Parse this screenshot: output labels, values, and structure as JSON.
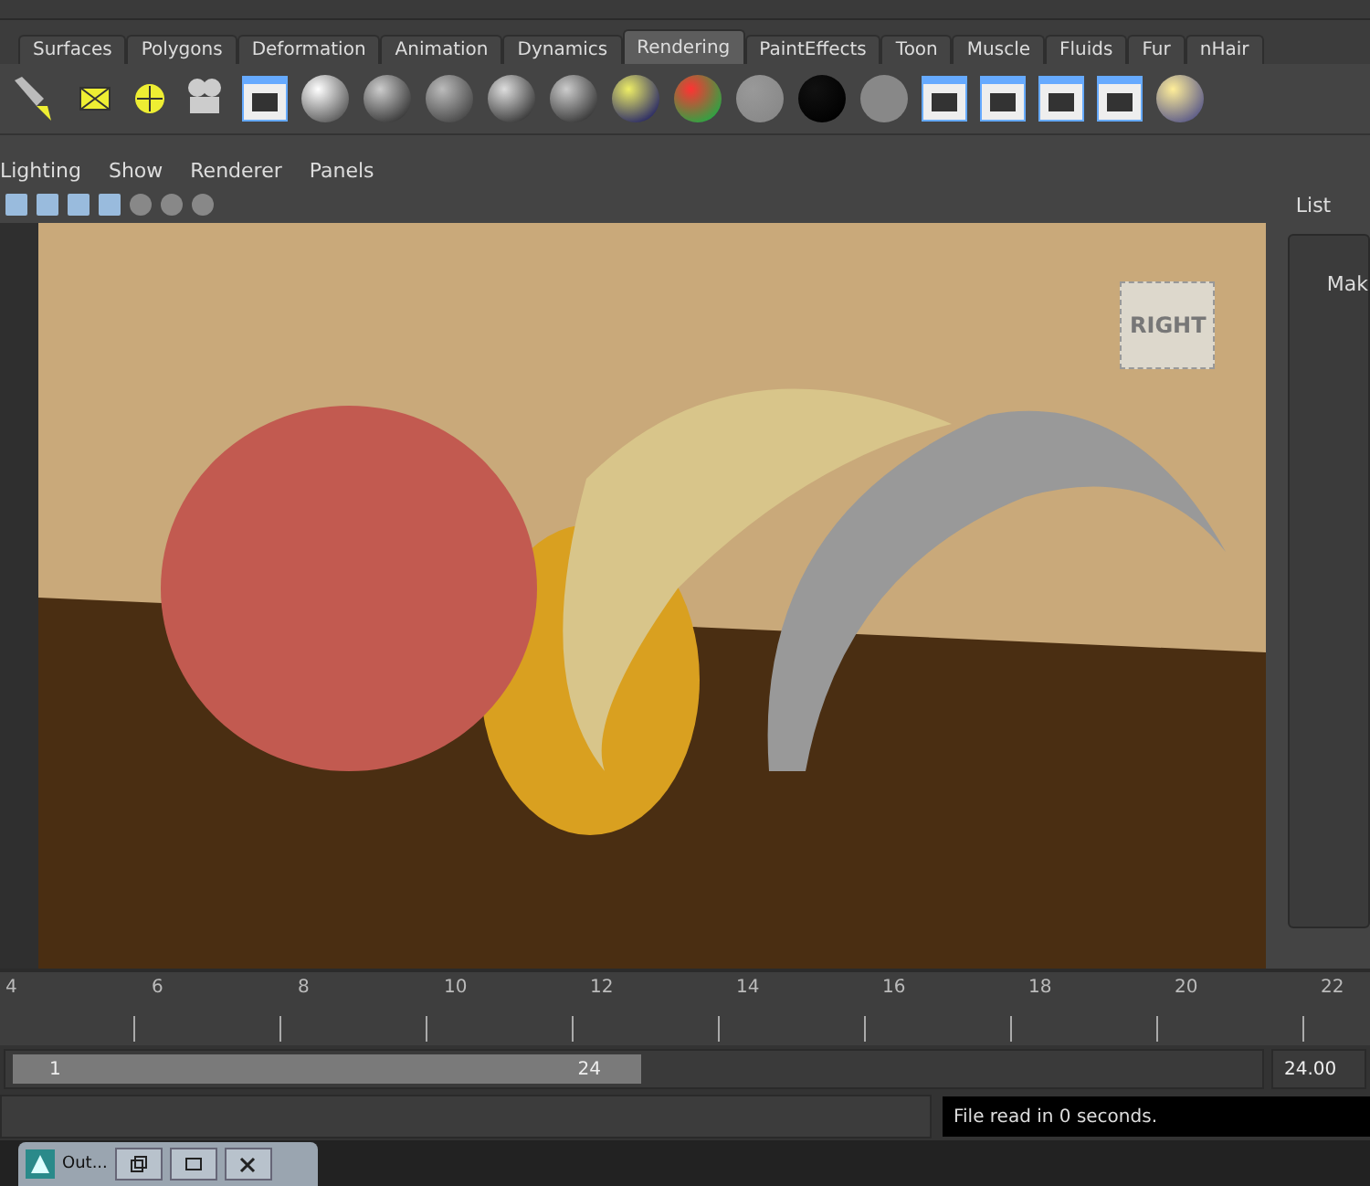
{
  "shelf_tabs": [
    {
      "label": "Surfaces",
      "selected": false
    },
    {
      "label": "Polygons",
      "selected": false
    },
    {
      "label": "Deformation",
      "selected": false
    },
    {
      "label": "Animation",
      "selected": false
    },
    {
      "label": "Dynamics",
      "selected": false
    },
    {
      "label": "Rendering",
      "selected": true
    },
    {
      "label": "PaintEffects",
      "selected": false
    },
    {
      "label": "Toon",
      "selected": false
    },
    {
      "label": "Muscle",
      "selected": false
    },
    {
      "label": "Fluids",
      "selected": false
    },
    {
      "label": "Fur",
      "selected": false
    },
    {
      "label": "nHair",
      "selected": false
    }
  ],
  "panel_menu": [
    "Lighting",
    "Show",
    "Renderer",
    "Panels"
  ],
  "viewport": {
    "view_cube": "RIGHT"
  },
  "side_panel": {
    "menu": "List",
    "content": "Mak"
  },
  "time_slider": {
    "ticks": [
      "4",
      "6",
      "8",
      "10",
      "12",
      "14",
      "16",
      "18",
      "20",
      "22"
    ]
  },
  "range_slider": {
    "level": 0.5,
    "start": "1",
    "end": "24",
    "end_field": "24.00"
  },
  "command_line": {
    "feedback": "File read in 0 seconds."
  },
  "taskbar": {
    "window_title": "Out..."
  }
}
